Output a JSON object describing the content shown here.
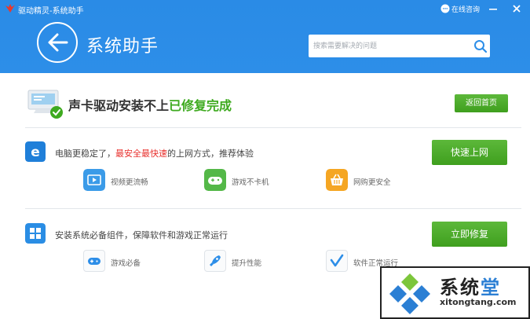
{
  "app": {
    "title": "驱动精灵-系统助手",
    "help_label": "在线咨询"
  },
  "header": {
    "page_title": "系统助手",
    "search_placeholder": "搜索需要解决的问题"
  },
  "status": {
    "text_main": "声卡驱动安装不上",
    "text_done": "已修复完成",
    "return_button": "返回首页"
  },
  "internet_section": {
    "text_before": "电脑更稳定了，",
    "text_highlight": "最安全最快速",
    "text_after": "的上网方式，推荐体验",
    "button": "快速上网",
    "features": [
      {
        "label": "视频更流畅",
        "icon": "video-icon"
      },
      {
        "label": "游戏不卡机",
        "icon": "gamepad-icon"
      },
      {
        "label": "网购更安全",
        "icon": "shopping-basket-icon"
      }
    ]
  },
  "components_section": {
    "text": "安装系统必备组件，保障软件和游戏正常运行",
    "button": "立即修复",
    "features": [
      {
        "label": "游戏必备",
        "icon": "gamepad-icon"
      },
      {
        "label": "提升性能",
        "icon": "rocket-icon"
      },
      {
        "label": "软件正常运行",
        "icon": "check-icon"
      }
    ]
  },
  "watermark": {
    "title_part1": "系统",
    "title_part2": "堂",
    "url": "xitongtang.com"
  },
  "colors": {
    "header_blue": "#2d8ee8",
    "button_green": "#4caa28",
    "highlight_red": "#e8302d",
    "success_green": "#3eaa1f"
  }
}
